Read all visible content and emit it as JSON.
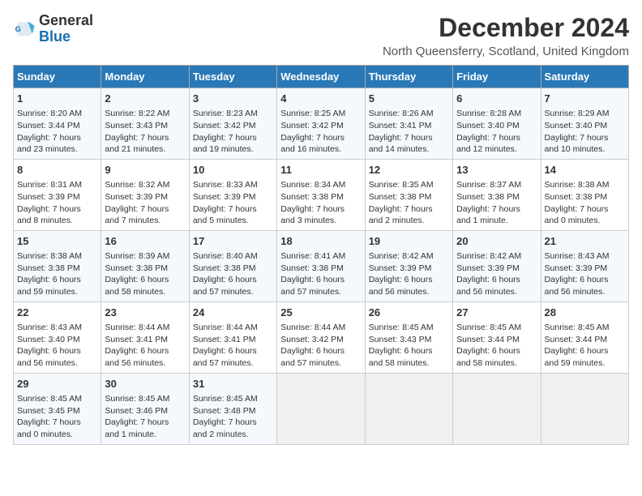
{
  "logo": {
    "text_general": "General",
    "text_blue": "Blue"
  },
  "title": "December 2024",
  "subtitle": "North Queensferry, Scotland, United Kingdom",
  "weekdays": [
    "Sunday",
    "Monday",
    "Tuesday",
    "Wednesday",
    "Thursday",
    "Friday",
    "Saturday"
  ],
  "weeks": [
    [
      {
        "day": "1",
        "detail": "Sunrise: 8:20 AM\nSunset: 3:44 PM\nDaylight: 7 hours\nand 23 minutes."
      },
      {
        "day": "2",
        "detail": "Sunrise: 8:22 AM\nSunset: 3:43 PM\nDaylight: 7 hours\nand 21 minutes."
      },
      {
        "day": "3",
        "detail": "Sunrise: 8:23 AM\nSunset: 3:42 PM\nDaylight: 7 hours\nand 19 minutes."
      },
      {
        "day": "4",
        "detail": "Sunrise: 8:25 AM\nSunset: 3:42 PM\nDaylight: 7 hours\nand 16 minutes."
      },
      {
        "day": "5",
        "detail": "Sunrise: 8:26 AM\nSunset: 3:41 PM\nDaylight: 7 hours\nand 14 minutes."
      },
      {
        "day": "6",
        "detail": "Sunrise: 8:28 AM\nSunset: 3:40 PM\nDaylight: 7 hours\nand 12 minutes."
      },
      {
        "day": "7",
        "detail": "Sunrise: 8:29 AM\nSunset: 3:40 PM\nDaylight: 7 hours\nand 10 minutes."
      }
    ],
    [
      {
        "day": "8",
        "detail": "Sunrise: 8:31 AM\nSunset: 3:39 PM\nDaylight: 7 hours\nand 8 minutes."
      },
      {
        "day": "9",
        "detail": "Sunrise: 8:32 AM\nSunset: 3:39 PM\nDaylight: 7 hours\nand 7 minutes."
      },
      {
        "day": "10",
        "detail": "Sunrise: 8:33 AM\nSunset: 3:39 PM\nDaylight: 7 hours\nand 5 minutes."
      },
      {
        "day": "11",
        "detail": "Sunrise: 8:34 AM\nSunset: 3:38 PM\nDaylight: 7 hours\nand 3 minutes."
      },
      {
        "day": "12",
        "detail": "Sunrise: 8:35 AM\nSunset: 3:38 PM\nDaylight: 7 hours\nand 2 minutes."
      },
      {
        "day": "13",
        "detail": "Sunrise: 8:37 AM\nSunset: 3:38 PM\nDaylight: 7 hours\nand 1 minute."
      },
      {
        "day": "14",
        "detail": "Sunrise: 8:38 AM\nSunset: 3:38 PM\nDaylight: 7 hours\nand 0 minutes."
      }
    ],
    [
      {
        "day": "15",
        "detail": "Sunrise: 8:38 AM\nSunset: 3:38 PM\nDaylight: 6 hours\nand 59 minutes."
      },
      {
        "day": "16",
        "detail": "Sunrise: 8:39 AM\nSunset: 3:38 PM\nDaylight: 6 hours\nand 58 minutes."
      },
      {
        "day": "17",
        "detail": "Sunrise: 8:40 AM\nSunset: 3:38 PM\nDaylight: 6 hours\nand 57 minutes."
      },
      {
        "day": "18",
        "detail": "Sunrise: 8:41 AM\nSunset: 3:38 PM\nDaylight: 6 hours\nand 57 minutes."
      },
      {
        "day": "19",
        "detail": "Sunrise: 8:42 AM\nSunset: 3:39 PM\nDaylight: 6 hours\nand 56 minutes."
      },
      {
        "day": "20",
        "detail": "Sunrise: 8:42 AM\nSunset: 3:39 PM\nDaylight: 6 hours\nand 56 minutes."
      },
      {
        "day": "21",
        "detail": "Sunrise: 8:43 AM\nSunset: 3:39 PM\nDaylight: 6 hours\nand 56 minutes."
      }
    ],
    [
      {
        "day": "22",
        "detail": "Sunrise: 8:43 AM\nSunset: 3:40 PM\nDaylight: 6 hours\nand 56 minutes."
      },
      {
        "day": "23",
        "detail": "Sunrise: 8:44 AM\nSunset: 3:41 PM\nDaylight: 6 hours\nand 56 minutes."
      },
      {
        "day": "24",
        "detail": "Sunrise: 8:44 AM\nSunset: 3:41 PM\nDaylight: 6 hours\nand 57 minutes."
      },
      {
        "day": "25",
        "detail": "Sunrise: 8:44 AM\nSunset: 3:42 PM\nDaylight: 6 hours\nand 57 minutes."
      },
      {
        "day": "26",
        "detail": "Sunrise: 8:45 AM\nSunset: 3:43 PM\nDaylight: 6 hours\nand 58 minutes."
      },
      {
        "day": "27",
        "detail": "Sunrise: 8:45 AM\nSunset: 3:44 PM\nDaylight: 6 hours\nand 58 minutes."
      },
      {
        "day": "28",
        "detail": "Sunrise: 8:45 AM\nSunset: 3:44 PM\nDaylight: 6 hours\nand 59 minutes."
      }
    ],
    [
      {
        "day": "29",
        "detail": "Sunrise: 8:45 AM\nSunset: 3:45 PM\nDaylight: 7 hours\nand 0 minutes."
      },
      {
        "day": "30",
        "detail": "Sunrise: 8:45 AM\nSunset: 3:46 PM\nDaylight: 7 hours\nand 1 minute."
      },
      {
        "day": "31",
        "detail": "Sunrise: 8:45 AM\nSunset: 3:48 PM\nDaylight: 7 hours\nand 2 minutes."
      },
      null,
      null,
      null,
      null
    ]
  ]
}
